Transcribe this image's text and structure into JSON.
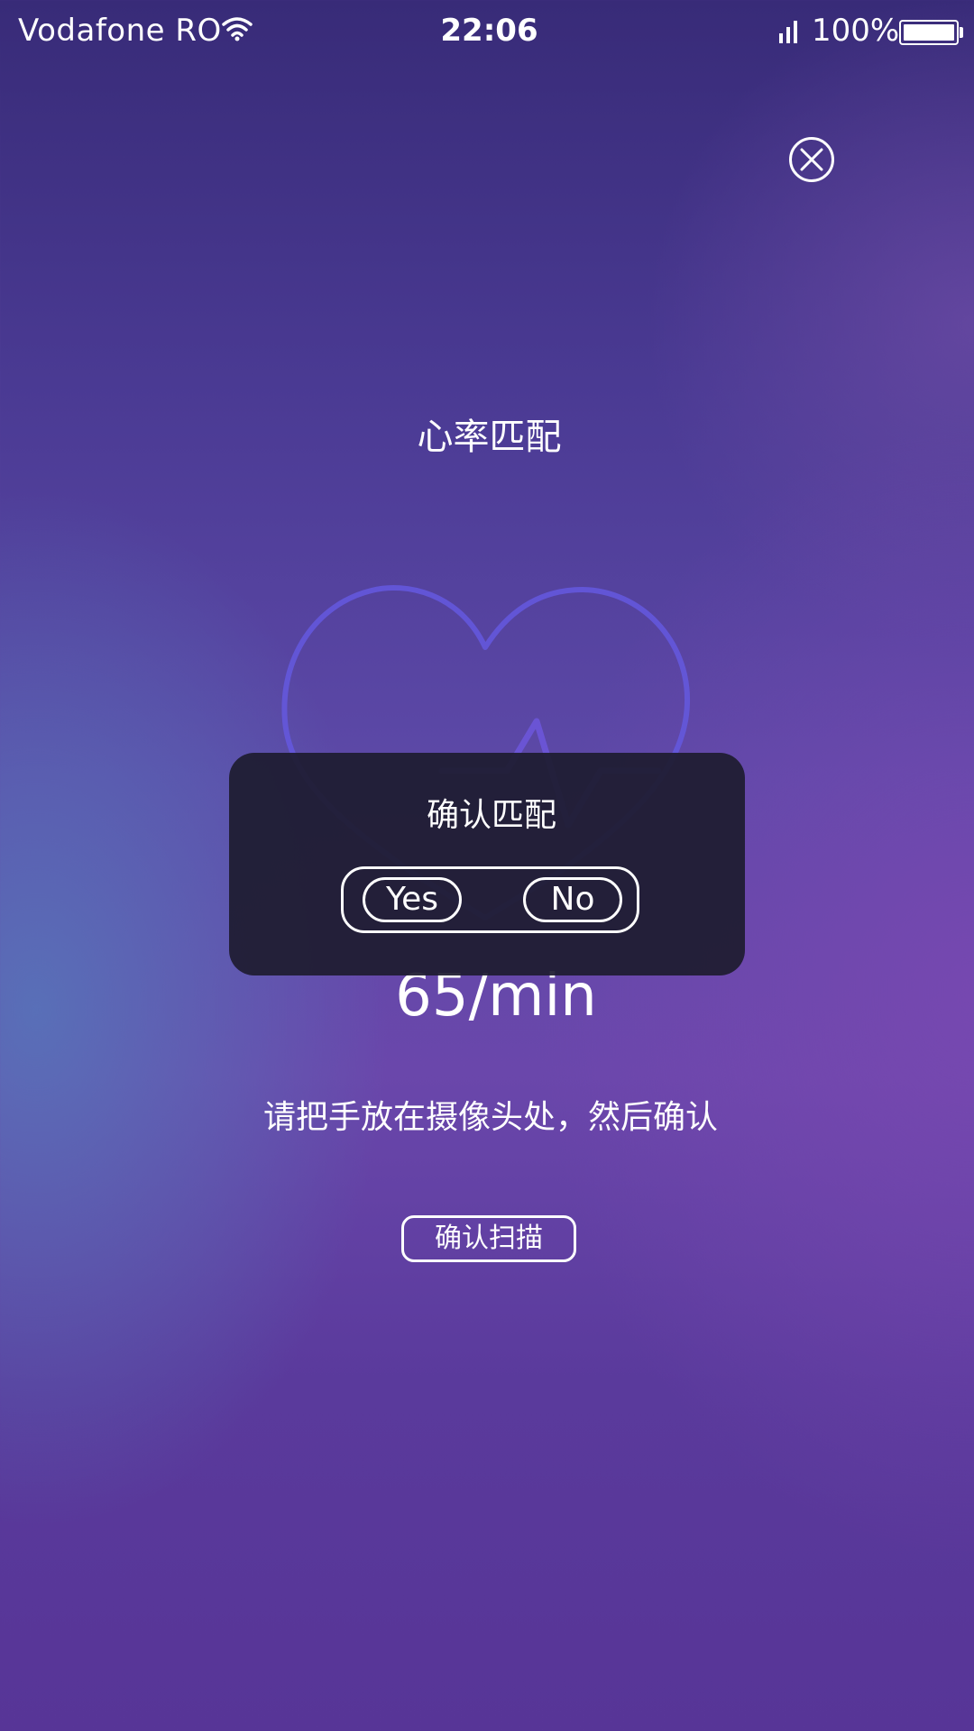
{
  "status_bar": {
    "carrier": "Vodafone RO",
    "time": "22:06",
    "battery_percent": "100%",
    "battery_level": 1.0,
    "icons": [
      "wifi-icon",
      "signal-icon",
      "battery-icon"
    ]
  },
  "header": {
    "close_icon": "close-circle-icon"
  },
  "main": {
    "title": "心率匹配",
    "heart_icon": "heart-pulse-icon",
    "bpm": "65/min",
    "instruction": "请把手放在摄像头处，然后确认",
    "scan_button_label": "确认扫描"
  },
  "dialog": {
    "title": "确认匹配",
    "yes_label": "Yes",
    "no_label": "No"
  },
  "colors": {
    "background_top": "#382b78",
    "background_mid": "#6a47ab",
    "heart_stroke": "#6a5ce0",
    "dialog_bg": "#1e1c30",
    "text": "#ffffff"
  }
}
